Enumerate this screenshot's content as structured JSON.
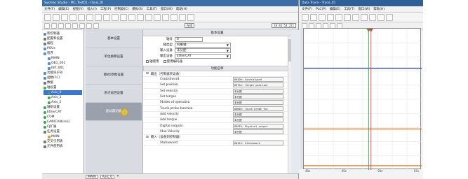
{
  "colors": {
    "accent": "#3a6ea5",
    "selected": "#3875d7",
    "scope_blue": "#2e4f9a",
    "scope_orange": "#e07b2a",
    "scope_green": "#35a853",
    "scope_red": "#d94040"
  },
  "left": {
    "title": "Sysmac Studio - MC_Test01 - [Axis_0]",
    "menu": [
      "文件(F)",
      "编辑(E)",
      "视图(V)",
      "插入(I)",
      "工程(P)",
      "控制器(C)",
      "模拟(S)",
      "工具(T)",
      "窗口(W)",
      "帮助(H)"
    ],
    "time_display": "18:44:53:221",
    "online_label": "在线"
  },
  "tree": {
    "items": [
      "新控制器",
      "配置和设置",
      "编程",
      "POUs",
      "程序",
      "MAIN",
      "OB1_001",
      "INT_001",
      "功能块(FB)",
      "函数(FC)",
      "数据",
      "轴设置",
      "Axis_0",
      "Axis_1",
      "Axis_2",
      "轴组设置",
      "EtherCAT",
      "COM",
      "CAN(CANLink)",
      "CJ扩展",
      "任务设置",
      "MAIN",
      "交叉引用表",
      "元件使用表"
    ]
  },
  "nav": {
    "items": [
      "基本设置",
      "单位换算设置",
      "模式/参数设置",
      "原点返回设置",
      "驱动器功能"
    ]
  },
  "panel": {
    "basic_head": "基本设置",
    "fields": [
      {
        "label": "轴号",
        "value": "0"
      },
      {
        "label": "轴类型",
        "value": "伺服轴"
      },
      {
        "label": "输入设备",
        "value": "未分配"
      },
      {
        "label": "输出设备",
        "value": "EtherCAT"
      }
    ],
    "check_a": "轴使用",
    "check_b": "使用编码器",
    "func_head": "功能名称",
    "group_output": "输出（控制器到设备）",
    "params": [
      {
        "name": "Controlword",
        "value": "6040h: Controlword"
      },
      {
        "name": "Set position",
        "value": "607Ah: Target position"
      },
      {
        "name": "Set velocity",
        "value": "未分配"
      },
      {
        "name": "Set torque",
        "value": "未分配"
      },
      {
        "name": "Modes of operation",
        "value": "未分配"
      },
      {
        "name": "Touch probe function",
        "value": "60B8h: Touch probe fun"
      },
      {
        "name": "Add velocity",
        "value": "未分配"
      },
      {
        "name": "Add torque",
        "value": "未分配"
      },
      {
        "name": "Digital outputs",
        "value": "60FEh: Physical output"
      },
      {
        "name": "Max Velocity",
        "value": "未分配"
      }
    ],
    "group_input": "输入（设备到控制器）",
    "input_params": [
      {
        "name": "Statusword",
        "value": "6041h: Statusword"
      }
    ]
  },
  "bottom": {
    "tabs": [
      "MAIN",
      "Axis_0"
    ]
  },
  "right": {
    "title": "Data Trace - Trace_01",
    "menu": [
      "文件(F)",
      "PLC(P)",
      "编辑(E)",
      "工具(T)",
      "窗口(W)",
      "帮助(H)"
    ]
  },
  "chart_data": {
    "type": "line",
    "x_ticks": [
      "40s",
      "45s",
      "50s",
      "55s"
    ],
    "series": [
      {
        "color": "#2e4f9a",
        "kind": "horizontal",
        "level": 0.72
      },
      {
        "color": "#e07b2a",
        "kind": "horizontal",
        "level": 0.29
      },
      {
        "color": "#e07b2a",
        "kind": "horizontal",
        "level": 0.03
      },
      {
        "color": "#35a853",
        "kind": "vertical",
        "at": 0.55
      },
      {
        "color": "#d94040",
        "kind": "vertical",
        "at": 0.57
      }
    ],
    "grid": true
  }
}
